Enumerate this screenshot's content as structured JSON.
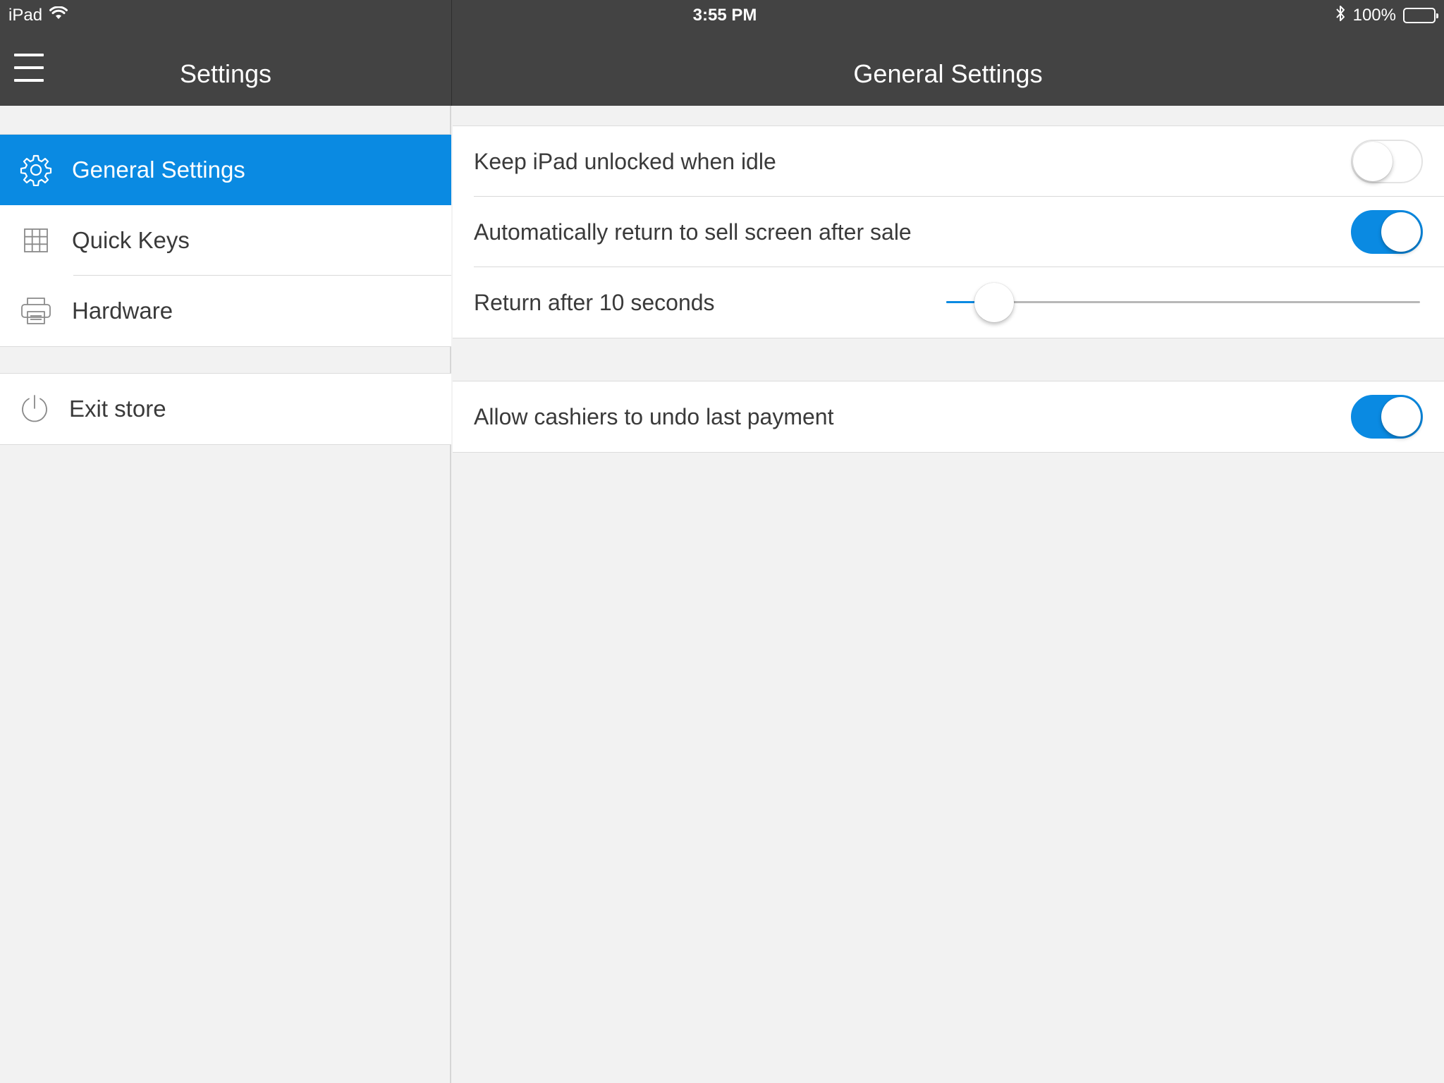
{
  "status_bar": {
    "device": "iPad",
    "time": "3:55 PM",
    "battery": "100%",
    "icons": [
      "wifi-icon",
      "bluetooth-icon",
      "battery-icon"
    ]
  },
  "header": {
    "left_title": "Settings",
    "right_title": "General Settings"
  },
  "sidebar": {
    "items": [
      {
        "label": "General Settings",
        "icon": "gear-icon",
        "active": true
      },
      {
        "label": "Quick Keys",
        "icon": "grid-icon",
        "active": false
      },
      {
        "label": "Hardware",
        "icon": "printer-icon",
        "active": false
      }
    ],
    "exit": {
      "label": "Exit store",
      "icon": "power-icon"
    }
  },
  "settings": {
    "keep_unlocked": {
      "label": "Keep iPad unlocked when idle",
      "value": false
    },
    "auto_return": {
      "label": "Automatically return to sell screen after sale",
      "value": true
    },
    "return_after": {
      "label": "Return after 10 seconds",
      "value_fraction": 0.05
    },
    "undo_payment": {
      "label": "Allow cashiers to undo last payment",
      "value": true
    }
  },
  "colors": {
    "accent": "#0a8ae2",
    "header_bg": "#434343",
    "background": "#f2f2f2"
  }
}
